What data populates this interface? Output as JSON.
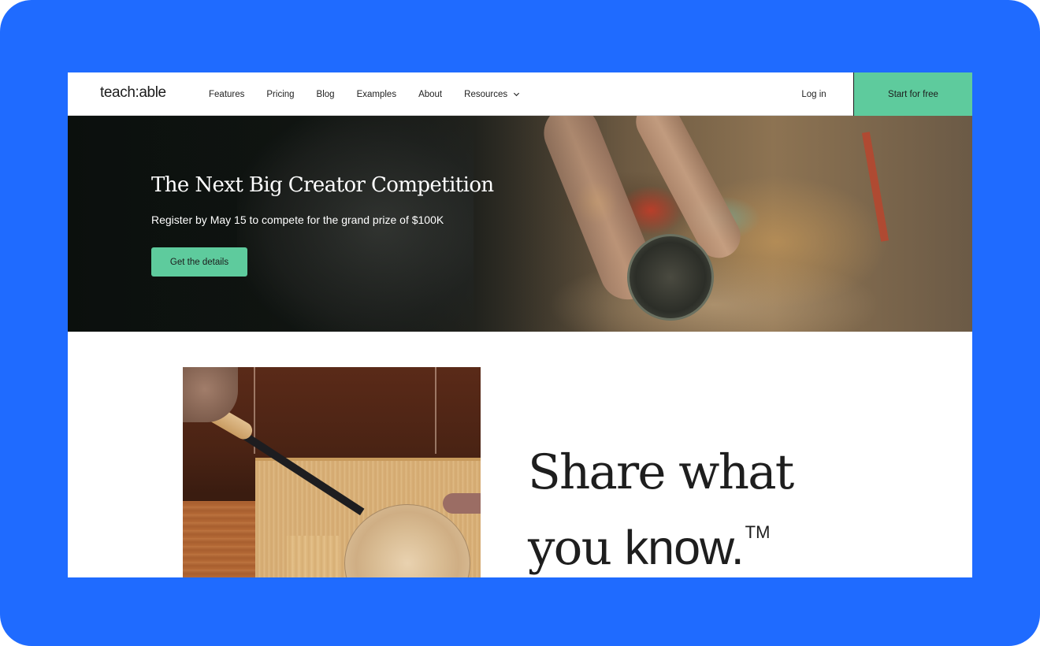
{
  "colors": {
    "frame_background": "#1f6bff",
    "brand_green": "#5ecb9d",
    "text_dark": "#1c1c1c"
  },
  "nav": {
    "logo": "teach:able",
    "links": [
      {
        "label": "Features"
      },
      {
        "label": "Pricing"
      },
      {
        "label": "Blog"
      },
      {
        "label": "Examples"
      },
      {
        "label": "About"
      },
      {
        "label": "Resources",
        "icon": "chevron-down-icon"
      }
    ],
    "login_label": "Log in",
    "cta_label": "Start for free"
  },
  "hero": {
    "title": "The Next Big Creator Competition",
    "subtitle": "Register by May 15 to compete for the grand prize of $100K",
    "button_label": "Get the details",
    "image_description": "craftsperson working at a workbench with cables"
  },
  "feature": {
    "image_description": "hands carving a wooden plate with a chisel",
    "tagline_line1": "Share what",
    "tagline_line2_serif": "you ",
    "tagline_line2_sans": "know.",
    "trademark": "TM"
  }
}
